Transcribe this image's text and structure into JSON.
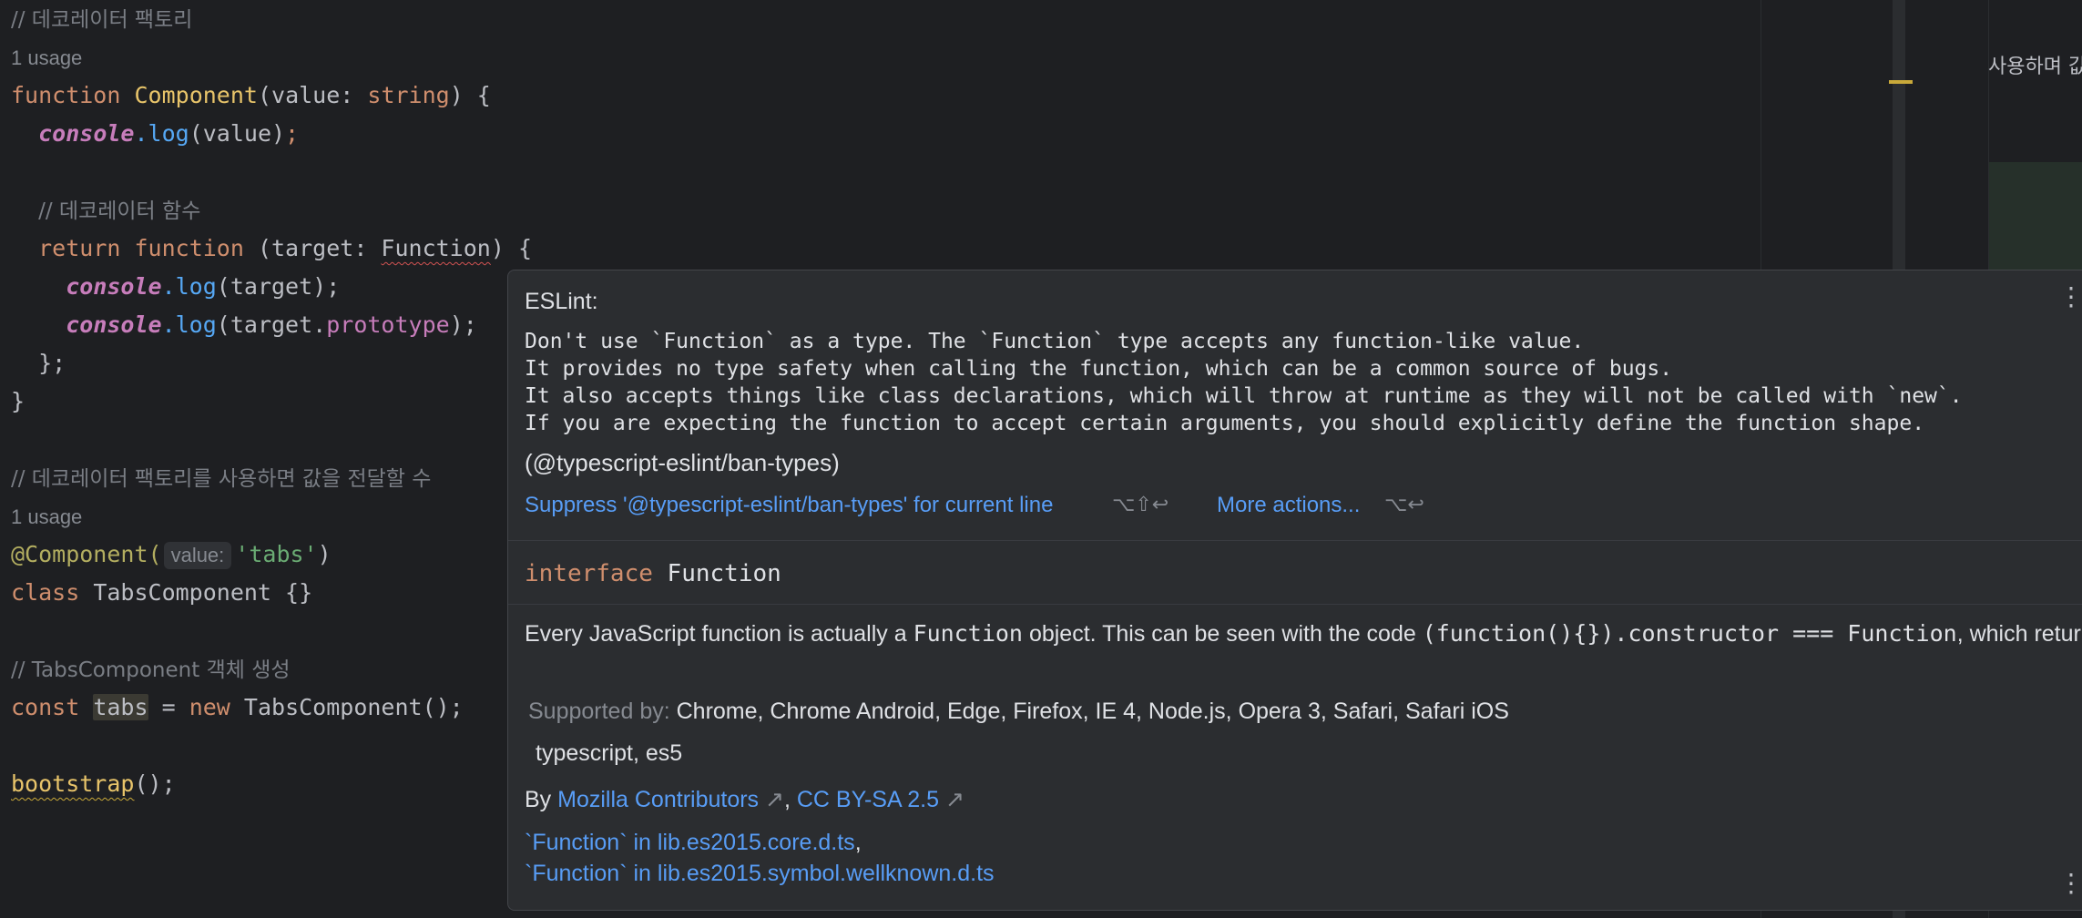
{
  "editor": {
    "comment_factory": "// 데코레이터 팩토리",
    "usage_1": "1 usage",
    "kw_function": "function",
    "component_name": "Component",
    "param_value": "value",
    "colon": ": ",
    "type_string": "string",
    "sig_end": ") {",
    "paren_open": "(",
    "console": "console",
    "dot_log": ".log",
    "arg_value": "(value)",
    "semicolon": ";",
    "comment_decorator_fn": "// 데코레이터 함수",
    "kw_return": "return",
    "fn_sig_open": " (target: ",
    "type_function": "Function",
    "arg_target": "(target);",
    "arg_target_open": "(target.",
    "prop_prototype": "prototype",
    "close_paren_semi": ");",
    "close_inner": "};",
    "close_outer": "}",
    "comment_factory_usage": "// 데코레이터 팩토리를 사용하면 값을 전달할 수",
    "usage_2": "1 usage",
    "decorator": "@Component(",
    "inlay_value": "value:",
    "str_tabs": "'tabs'",
    "close_paren": ")",
    "kw_class": "class",
    "class_decl": " TabsComponent {}",
    "comment_create": "// TabsComponent 객체 생성",
    "kw_const": "const",
    "var_tabs": "tabs",
    "assign": " = ",
    "kw_new": "new",
    "new_call": " TabsComponent();",
    "bootstrap": "bootstrap",
    "bootstrap_end": "();"
  },
  "right_panel": {
    "text": "사용하며 값"
  },
  "popup": {
    "title": "ESLint:",
    "messages": [
      "Don't use `Function` as a type. The `Function` type accepts any function-like value.",
      "It provides no type safety when calling the function, which can be a common source of bugs.",
      "It also accepts things like class declarations, which will throw at runtime as they will not be called with `new`.",
      "If you are expecting the function to accept certain arguments, you should explicitly define the function shape."
    ],
    "rule": "(@typescript-eslint/ban-types)",
    "suppress_label": "Suppress '@typescript-eslint/ban-types' for current line",
    "suppress_shortcut": "⌥⇧↩",
    "more_actions_label": "More actions...",
    "more_actions_shortcut": "⌥↩",
    "menu_dots": "⋮",
    "interface_kw": "interface",
    "interface_name": "Function",
    "desc_1": "Every JavaScript function is actually a ",
    "desc_code_1": "Function",
    "desc_2": " object. This can be seen with the code ",
    "desc_code_2": "(function(){}).constructor === Function",
    "desc_3": ", which returns true.",
    "supported_label": "Supported by:",
    "supported_value": "Chrome, Chrome Android, Edge, Firefox, IE 4, Node.js, Opera 3, Safari, Safari iOS",
    "ts_es5": "typescript, es5",
    "by_label": "By",
    "by_link": "Mozilla Contributors",
    "arrow": "↗",
    "comma": ",",
    "license_link": "CC BY-SA 2.5",
    "ref_1": "`Function` in lib.es2015.core.d.ts",
    "ref_2": "`Function` in lib.es2015.symbol.wellknown.d.ts"
  },
  "colors": {
    "background": "#1e1f22",
    "keyword": "#cf8e6d",
    "function": "#e8c46a",
    "string": "#6aab73",
    "link": "#589df6",
    "popup_bg": "#2b2d30"
  }
}
